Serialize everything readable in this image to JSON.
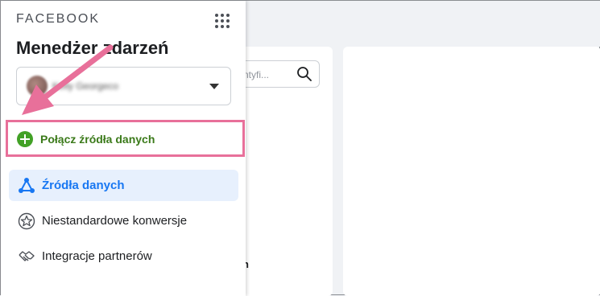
{
  "brand": "FACEBOOK",
  "title": "Menedżer zdarzeń",
  "account": {
    "name": "Kelly Georgeco"
  },
  "search": {
    "placeholder": "ntyfi..."
  },
  "connect": {
    "label": "Połącz źródła danych"
  },
  "nav": [
    {
      "label": "Źródła danych",
      "icon": "data-sources-icon",
      "active": true
    },
    {
      "label": "Niestandardowe konwersje",
      "icon": "star-icon",
      "active": false
    },
    {
      "label": "Integracje partnerów",
      "icon": "handshake-icon",
      "active": false
    }
  ],
  "stray": "n",
  "colors": {
    "accent": "#1877f2",
    "connect_green": "#42a126",
    "highlight": "#e8709a"
  }
}
